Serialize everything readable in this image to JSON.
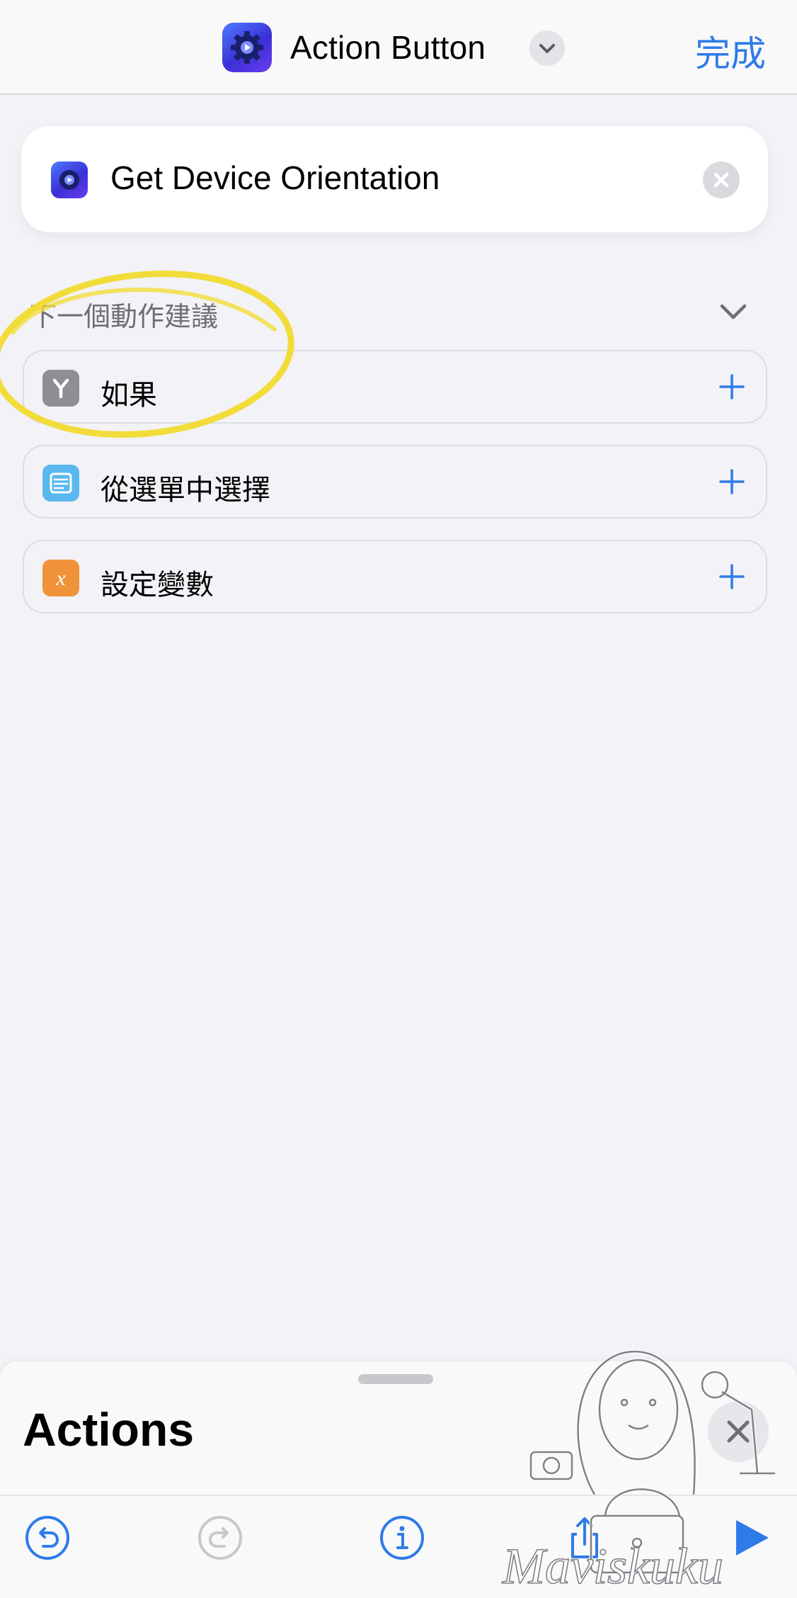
{
  "nav": {
    "title": "Action Button",
    "done_label": "完成"
  },
  "action_card": {
    "title": "Get Device Orientation"
  },
  "suggestions": {
    "header": "下一個動作建議",
    "items": [
      {
        "label": "如果",
        "icon": "if-branch-icon",
        "color": "#8e8e93"
      },
      {
        "label": "從選單中選擇",
        "icon": "menu-list-icon",
        "color": "#5ab8ef"
      },
      {
        "label": "設定變數",
        "icon": "variable-x-icon",
        "color": "#f0923a"
      }
    ]
  },
  "sheet": {
    "title": "Actions"
  },
  "toolbar": {
    "buttons": [
      "undo-icon",
      "redo-icon",
      "info-icon",
      "share-icon",
      "play-icon"
    ]
  },
  "watermark": {
    "text": "Maviskuku"
  },
  "colors": {
    "accent": "#2f7be8",
    "highlight": "#f2dc3a",
    "background": "#f2f2f7"
  }
}
